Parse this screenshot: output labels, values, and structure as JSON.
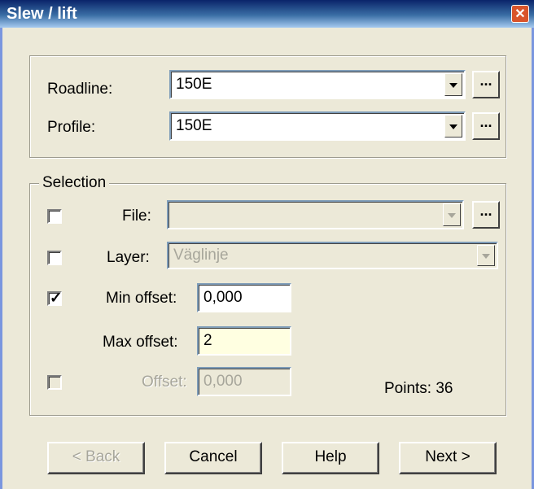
{
  "window": {
    "title": "Slew / lift",
    "close_icon": "close-icon"
  },
  "roadline": {
    "label": "Roadline:",
    "value": "150E",
    "browse_label": "..."
  },
  "profile": {
    "label": "Profile:",
    "value": "150E",
    "browse_label": "..."
  },
  "selection": {
    "legend": "Selection",
    "file": {
      "label": "File:",
      "value": "",
      "checked": false,
      "browse_label": "..."
    },
    "layer": {
      "label": "Layer:",
      "value": "Väglinje",
      "checked": false
    },
    "min_offset": {
      "label": "Min offset:",
      "value": "0,000",
      "checked": true
    },
    "max_offset": {
      "label": "Max offset:",
      "value": "2"
    },
    "offset": {
      "label": "Offset:",
      "value": "0,000",
      "checked": false
    },
    "points": "Points: 36"
  },
  "buttons": {
    "back": "< Back",
    "cancel": "Cancel",
    "help": "Help",
    "next": "Next >"
  }
}
